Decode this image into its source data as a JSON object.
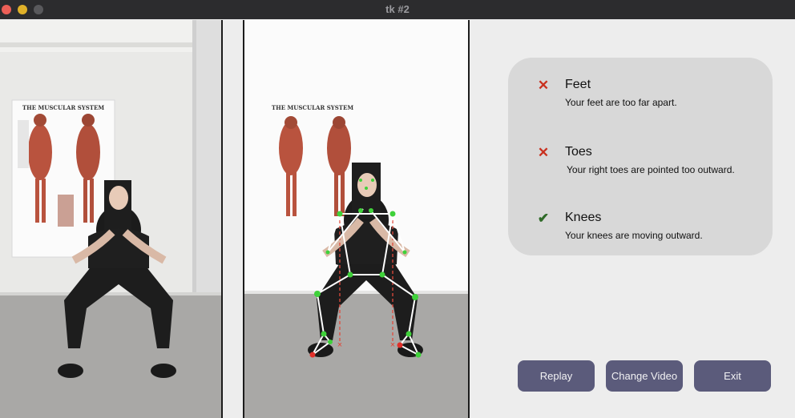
{
  "window": {
    "title": "tk #2"
  },
  "videos": {
    "original": {
      "poster_heading": "THE MUSCULAR SYSTEM"
    },
    "annotated": {
      "poster_heading": "THE MUSCULAR SYSTEM"
    }
  },
  "feedback": [
    {
      "title": "Feet",
      "message": "Your feet are too far apart.",
      "status": "fail",
      "icon": "cross-icon"
    },
    {
      "title": "Toes",
      "message": "Your right toes are pointed too outward.",
      "status": "fail",
      "icon": "cross-icon"
    },
    {
      "title": "Knees",
      "message": "Your knees are moving outward.",
      "status": "pass",
      "icon": "check-icon"
    }
  ],
  "buttons": {
    "replay": "Replay",
    "change_video": "Change Video",
    "exit": "Exit"
  },
  "colors": {
    "fail": "#c9311f",
    "pass": "#2f6a28",
    "button": "#5b5b7b",
    "card": "#d8d8d8",
    "skeleton": "#ffffff",
    "landmark": "#3fd13a",
    "alignment_line": "#e04a3c"
  }
}
